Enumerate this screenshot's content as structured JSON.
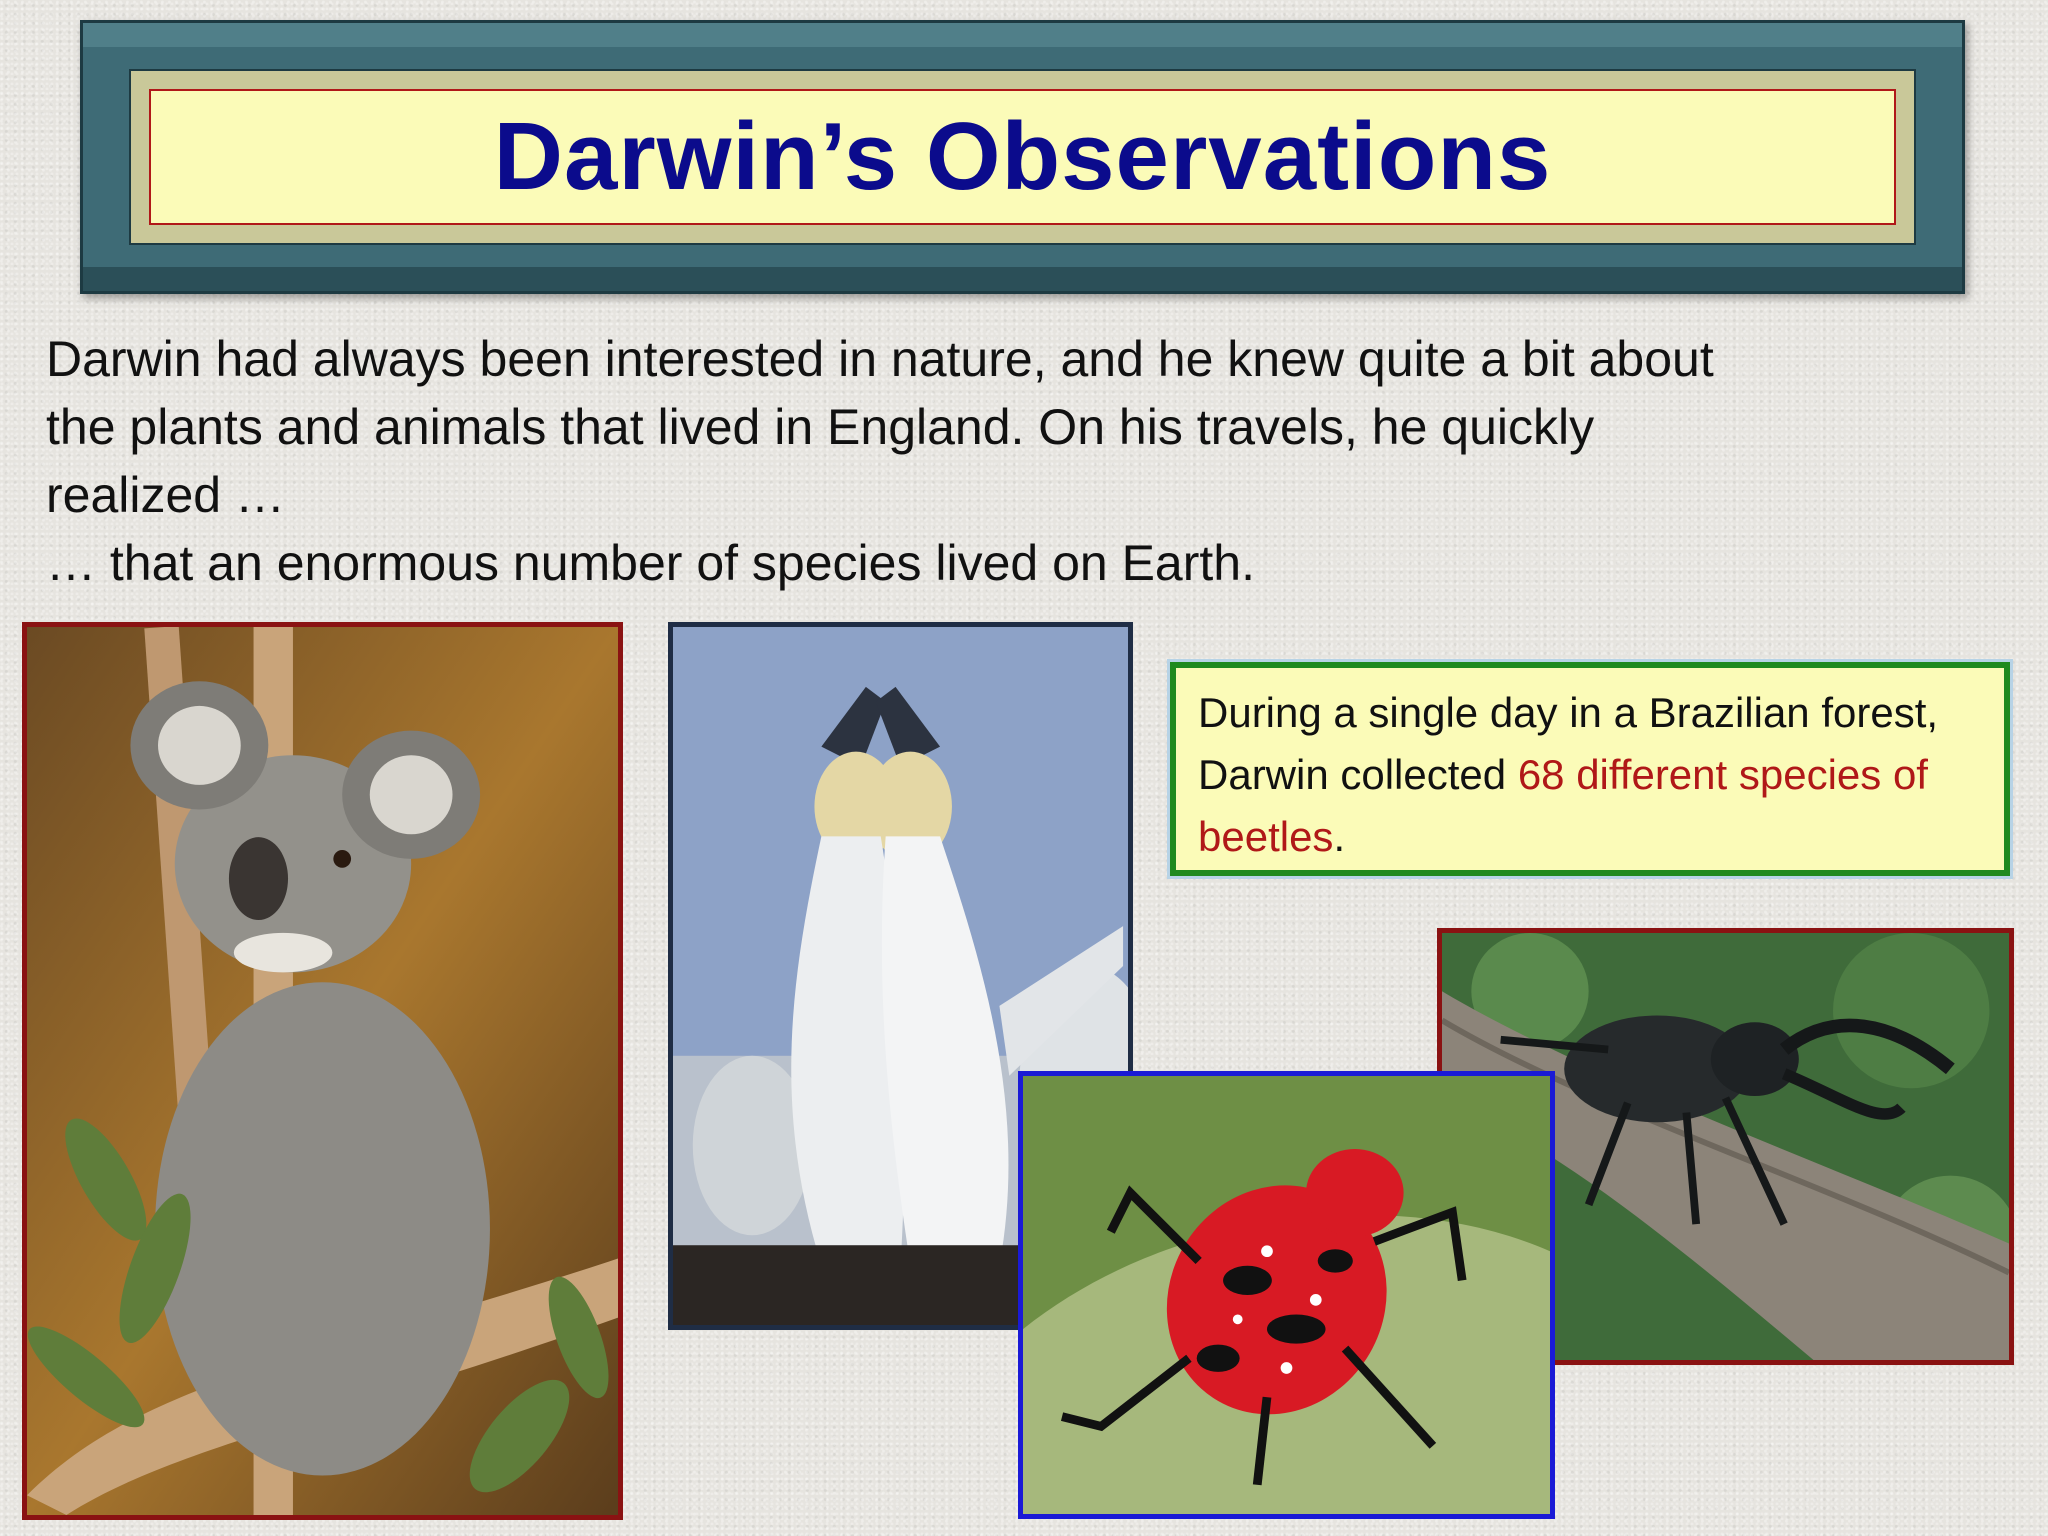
{
  "title": "Darwin’s Observations",
  "intro": {
    "line1": "Darwin had always been interested in nature, and he knew quite a bit about",
    "line2": "the plants and animals that lived in England.  On his travels, he quickly",
    "line3": "realized …",
    "line4": "… that an enormous number of species lived on Earth."
  },
  "callout": {
    "text_before": "During a single day in a Brazilian forest, Darwin collected ",
    "highlight": "68 different species of beetles",
    "text_after": "."
  },
  "colors": {
    "title": "#0b0b8c",
    "highlight": "#b01818",
    "callout_border": "#1f8a1f",
    "callout_bg": "#fbfbb8"
  },
  "images": [
    {
      "name": "koala-photo",
      "subject": "koala on eucalyptus tree"
    },
    {
      "name": "gannets-photo",
      "subject": "two gannets touching beaks"
    },
    {
      "name": "red-beetle-photo",
      "subject": "red and black spotted beetle on leaf"
    },
    {
      "name": "horned-beetle-photo",
      "subject": "black horned beetle on branch"
    }
  ]
}
